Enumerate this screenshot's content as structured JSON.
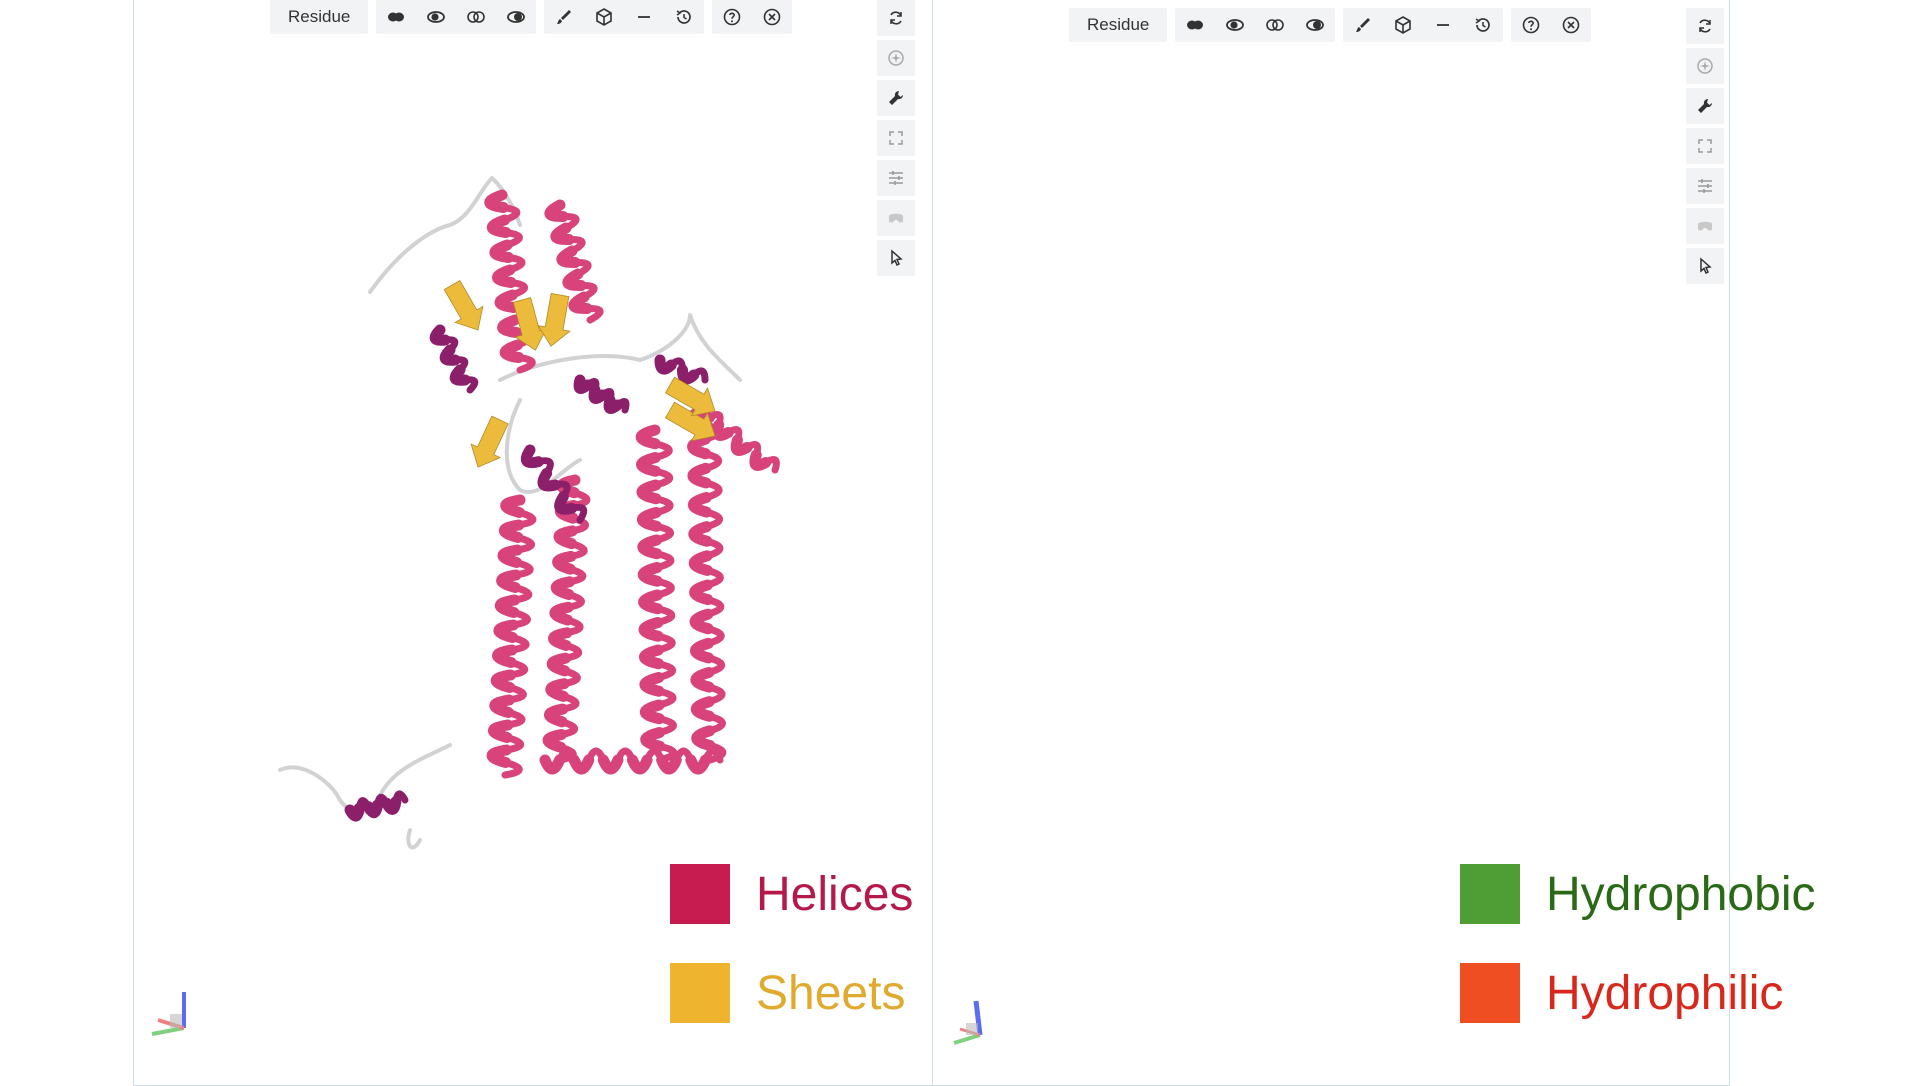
{
  "colors": {
    "helix": "#d7437a",
    "helix_dark": "#8c1f6a",
    "sheet": "#edbb3c",
    "coil": "#d2d2d4",
    "hydrophobic": "#3e8f2d",
    "hydrophobic_light": "#b6d08f",
    "neutral": "#ecd9a4",
    "hydrophilic": "#e2552d",
    "hydrophilic_dark": "#c4132e"
  },
  "left_viewer": {
    "toolbar": {
      "mode_label": "Residue",
      "icons": [
        "cartoon-icon",
        "half-toggle-icon",
        "outline-icon",
        "filled-toggle-icon",
        "brush-icon",
        "cube-icon",
        "minus-icon",
        "history-icon",
        "help-icon",
        "close-icon"
      ]
    },
    "sidebar_icons": [
      "rotate-icon",
      "spin-icon",
      "wrench-icon",
      "fullscreen-icon",
      "sliders-icon",
      "vr-icon",
      "pointer-icon"
    ],
    "legend": [
      {
        "label": "Helices",
        "swatch_color": "#c71c4f",
        "text_color": "#b5194a"
      },
      {
        "label": "Sheets",
        "swatch_color": "#efb42f",
        "text_color": "#e0aa2e"
      }
    ]
  },
  "right_viewer": {
    "toolbar": {
      "mode_label": "Residue",
      "icons": [
        "cartoon-icon",
        "half-toggle-icon",
        "outline-icon",
        "filled-toggle-icon",
        "brush-icon",
        "cube-icon",
        "minus-icon",
        "history-icon",
        "help-icon",
        "close-icon"
      ]
    },
    "sidebar_icons": [
      "rotate-icon",
      "spin-icon",
      "wrench-icon",
      "fullscreen-icon",
      "sliders-icon",
      "vr-icon",
      "pointer-icon"
    ],
    "legend": [
      {
        "label": "Hydrophobic",
        "swatch_color": "#4f9e35",
        "text_color": "#2a6a16"
      },
      {
        "label": "Hydrophilic",
        "swatch_color": "#ee4e22",
        "text_color": "#d8281c"
      }
    ]
  }
}
